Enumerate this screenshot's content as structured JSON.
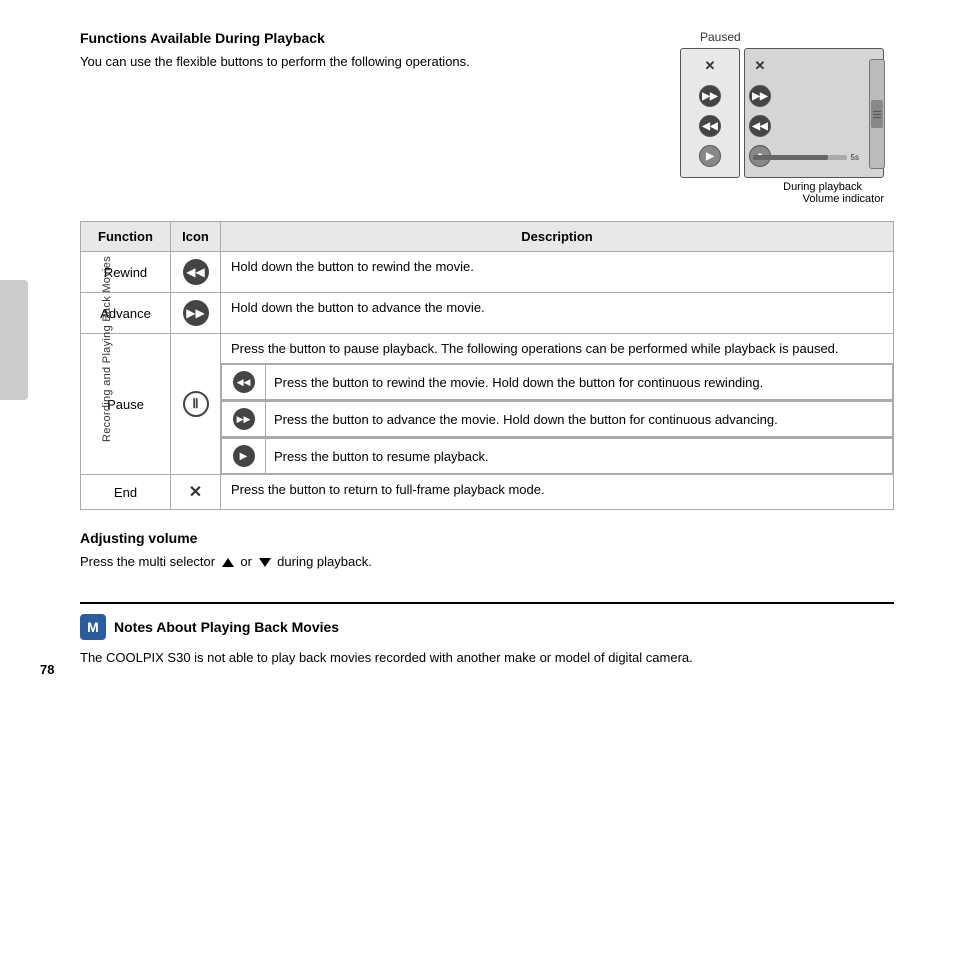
{
  "page": {
    "number": "78",
    "sidebar_label": "Recording and Playing Back Movies"
  },
  "section1": {
    "title": "Functions Available During Playback",
    "description": "You can use the flexible buttons to perform the following operations.",
    "paused_label": "Paused",
    "during_playback_label": "During playback",
    "volume_indicator_label": "Volume indicator"
  },
  "table": {
    "headers": [
      "Function",
      "Icon",
      "Description"
    ],
    "rows": [
      {
        "function": "Rewind",
        "icon": "rewind",
        "description": "Hold down the button to rewind the movie."
      },
      {
        "function": "Advance",
        "icon": "advance",
        "description": "Hold down the button to advance the movie."
      },
      {
        "function": "Pause",
        "icon": "pause",
        "description": "Press the button to pause playback. The following operations can be performed while playback is paused.",
        "sub_rows": [
          {
            "icon": "rewind-small",
            "description": "Press the button to rewind the movie. Hold down the button for continuous rewinding."
          },
          {
            "icon": "advance-small",
            "description": "Press the button to advance the movie. Hold down the button for continuous advancing."
          },
          {
            "icon": "play",
            "description": "Press the button to resume playback."
          }
        ]
      },
      {
        "function": "End",
        "icon": "x",
        "description": "Press the button to return to full-frame playback mode."
      }
    ]
  },
  "section2": {
    "title": "Adjusting volume",
    "description": "Press the multi selector",
    "or_text": "or",
    "suffix": "during playback."
  },
  "notes": {
    "icon_label": "M",
    "title": "Notes About Playing Back Movies",
    "text": "The COOLPIX S30 is not able to play back movies recorded with another make or model of digital camera."
  }
}
